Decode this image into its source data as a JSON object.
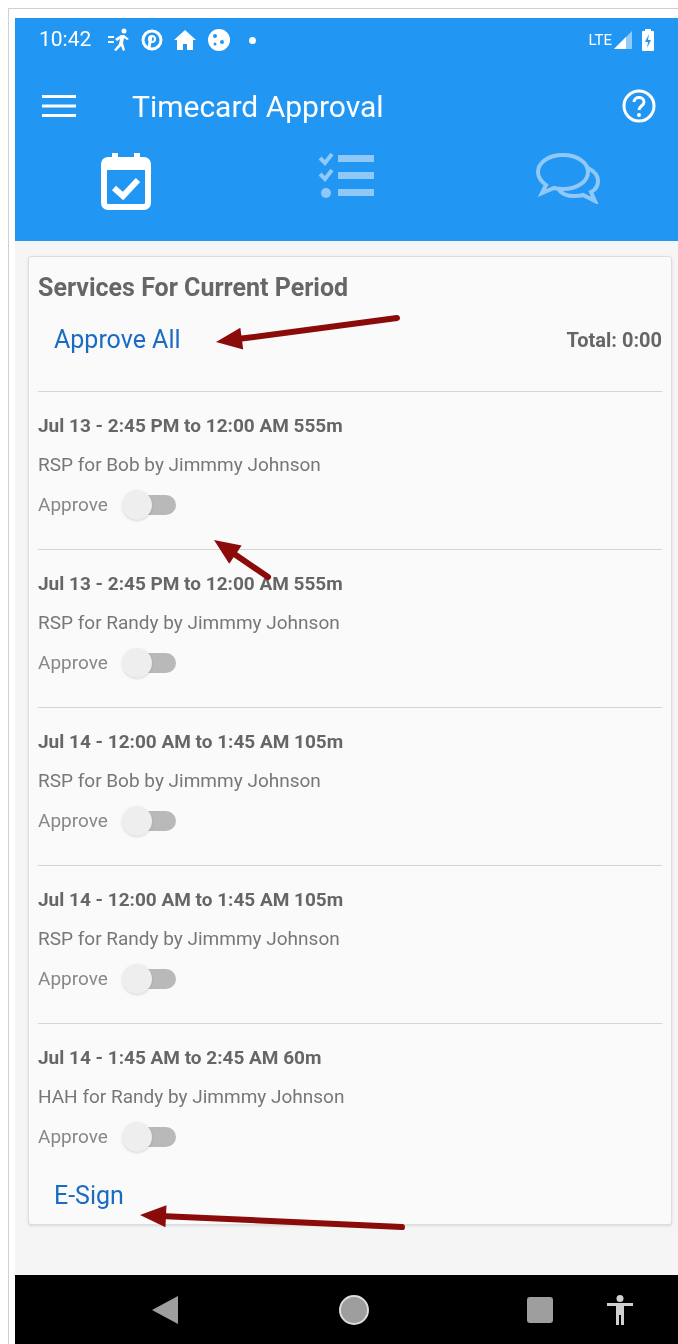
{
  "status_bar": {
    "time": "10:42",
    "network": "LTE"
  },
  "app_bar": {
    "title": "Timecard Approval"
  },
  "tabs": [
    {
      "kind": "calendar",
      "selected": true
    },
    {
      "kind": "checklist",
      "selected": false
    },
    {
      "kind": "chat",
      "selected": false
    }
  ],
  "card": {
    "title": "Services For Current Period",
    "approve_all": "Approve All",
    "total": "Total: 0:00",
    "services": [
      {
        "time": "Jul 13 - 2:45 PM to 12:00 AM 555m",
        "description": "RSP for Bob by Jimmmy Johnson",
        "approve_label": "Approve",
        "on": false
      },
      {
        "time": "Jul 13 - 2:45 PM to 12:00 AM 555m",
        "description": "RSP for Randy by Jimmmy Johnson",
        "approve_label": "Approve",
        "on": false
      },
      {
        "time": "Jul 14 - 12:00 AM to 1:45 AM 105m",
        "description": "RSP for Bob by Jimmmy Johnson",
        "approve_label": "Approve",
        "on": false
      },
      {
        "time": "Jul 14 - 12:00 AM to 1:45 AM 105m",
        "description": "RSP for Randy by Jimmmy Johnson",
        "approve_label": "Approve",
        "on": false
      },
      {
        "time": "Jul 14 - 1:45 AM to 2:45 AM 60m",
        "description": "HAH for Randy by Jimmmy Johnson",
        "approve_label": "Approve",
        "on": false
      }
    ],
    "esign": "E-Sign"
  }
}
